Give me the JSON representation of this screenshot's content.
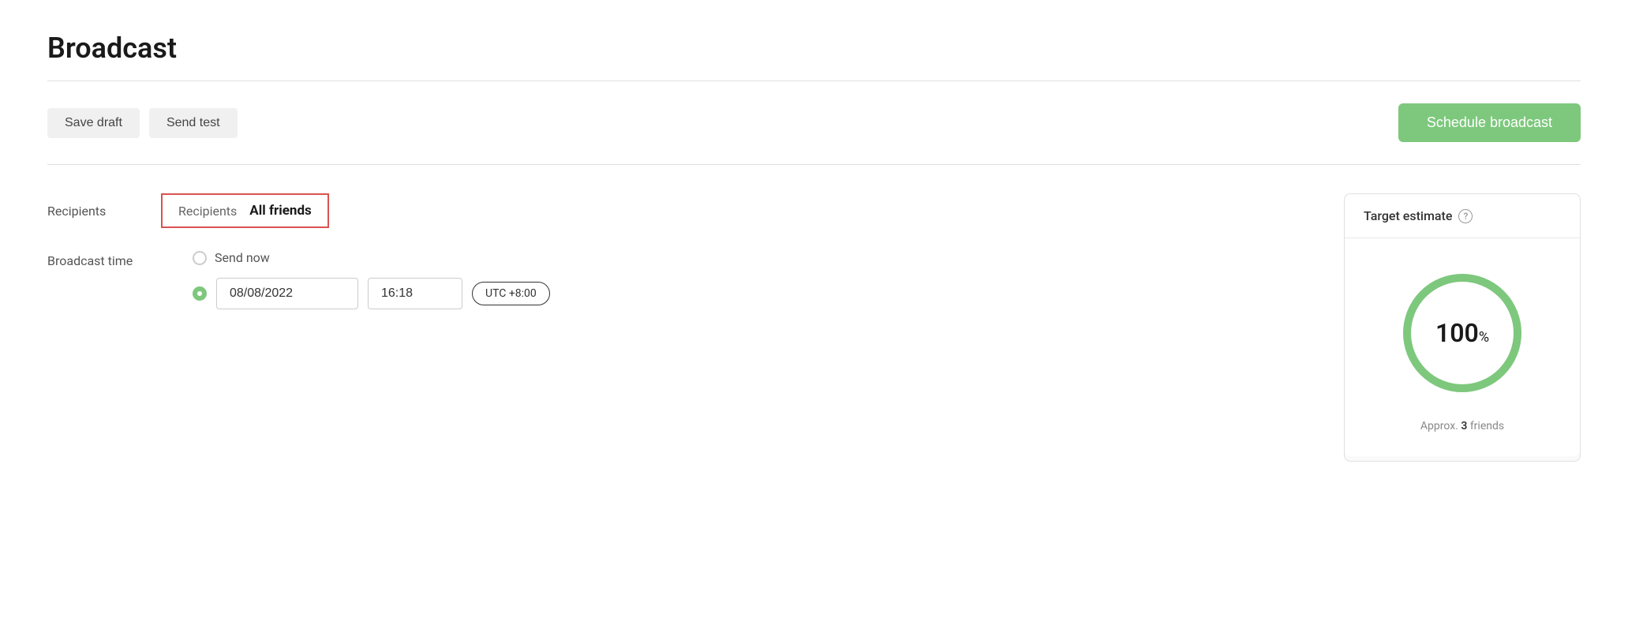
{
  "page": {
    "title": "Broadcast"
  },
  "toolbar": {
    "save_draft_label": "Save draft",
    "send_test_label": "Send test",
    "schedule_broadcast_label": "Schedule broadcast"
  },
  "form": {
    "recipients_label": "Recipients",
    "recipients_value": "All friends",
    "broadcast_time_label": "Broadcast time",
    "send_now_label": "Send now",
    "date_value": "08/08/2022",
    "time_value": "16:18",
    "timezone_value": "UTC +8:00"
  },
  "target_estimate": {
    "header_label": "Target estimate",
    "percentage": "100",
    "percent_sign": "%",
    "approx_label": "Approx.",
    "approx_count": "3",
    "approx_unit": "friends"
  },
  "colors": {
    "green": "#7dc87d",
    "red_border": "#d9534f",
    "text_dark": "#1a1a1a",
    "text_muted": "#888888"
  }
}
